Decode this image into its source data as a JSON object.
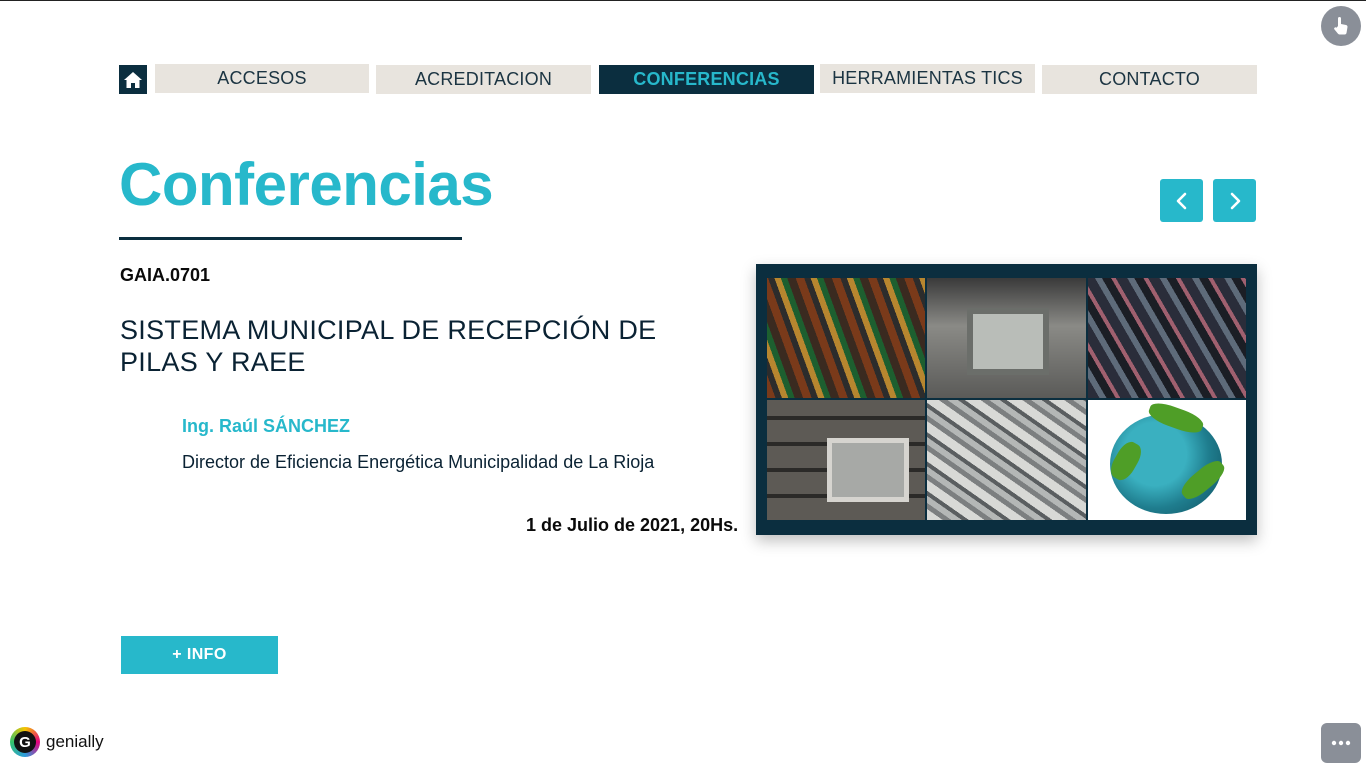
{
  "nav": {
    "home_icon": "home-icon",
    "items": [
      {
        "label": "ACCESOS",
        "active": false
      },
      {
        "label": "ACREDITACION",
        "active": false
      },
      {
        "label": "CONFERENCIAS",
        "active": true
      },
      {
        "label": "HERRAMIENTAS TICS",
        "active": false
      },
      {
        "label": "CONTACTO",
        "active": false
      }
    ]
  },
  "page": {
    "title": "Conferencias",
    "code": "GAIA.0701",
    "conference_title": "SISTEMA MUNICIPAL DE RECEPCIÓN DE PILAS Y RAEE",
    "speaker_name": "Ing. Raúl SÁNCHEZ",
    "speaker_role": "Director de Eficiencia Energética Municipalidad de La Rioja",
    "date": "1 de Julio de 2021, 20Hs.",
    "info_button": "+ INFO"
  },
  "controls": {
    "prev_icon": "chevron-left-icon",
    "next_icon": "chevron-right-icon",
    "accessibility_icon": "hand-pointer-icon",
    "more_icon": "ellipsis-icon"
  },
  "brand": {
    "name": "genially",
    "logo_letter": "G"
  },
  "colors": {
    "accent": "#27b8cb",
    "dark": "#0b2e3f",
    "nav_bg": "#e8e4de"
  }
}
